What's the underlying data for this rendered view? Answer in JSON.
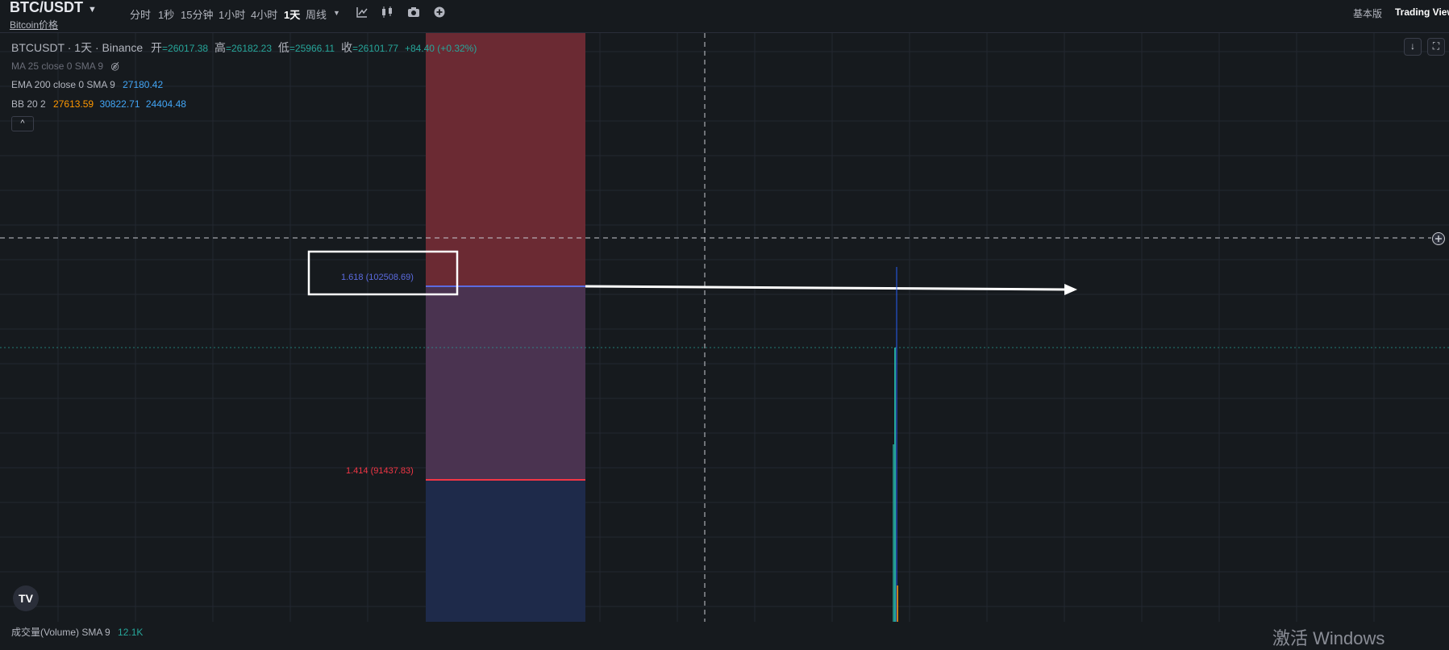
{
  "header": {
    "symbol": "BTC/USDT",
    "symbol_sub": "Bitcoin价格",
    "timeframes": [
      "分时",
      "1秒",
      "15分钟",
      "1小时",
      "4小时",
      "1天",
      "周线"
    ],
    "active_timeframe": "1天",
    "basic_version": "基本版",
    "trading_view": "Trading View"
  },
  "legend": {
    "pair": "BTCUSDT · 1天 · Binance",
    "open_label": "开",
    "open": "=26017.38",
    "high_label": "高",
    "high": "=26182.23",
    "low_label": "低",
    "low": "=25966.11",
    "close_label": "收",
    "close": "=26101.77",
    "change": "+84.40 (+0.32%)",
    "ma": "MA 25 close 0 SMA 9",
    "ema": "EMA 200 close 0 SMA 9",
    "ema_value": "27180.42",
    "bb": "BB 20 2",
    "bb_mid": "27613.59",
    "bb_upper": "30822.71",
    "bb_lower": "24404.48"
  },
  "fib": {
    "level_1618": "1.618 (102508.69)",
    "level_1414": "1.414 (91437.83)"
  },
  "footer": {
    "volume": "成交量(Volume) SMA 9",
    "volume_value": "12.1K",
    "watermark": "激活 Windows"
  },
  "colors": {
    "background": "#161a1e",
    "up": "#26a69a",
    "fib_red_zone": "#6b2a33",
    "fib_purple_zone": "#4a3350",
    "fib_blue_zone": "#1e2a4a",
    "fib_1618": "#5b6be0",
    "fib_1414": "#f23645"
  },
  "icons": [
    "caret-down-icon",
    "indicator-icon",
    "candle-icon",
    "camera-icon",
    "plus-icon",
    "eye-off-icon",
    "chevron-up-icon",
    "arrow-down-icon",
    "fullscreen-icon",
    "crosshair-plus-icon",
    "tradingview-logo-icon"
  ]
}
